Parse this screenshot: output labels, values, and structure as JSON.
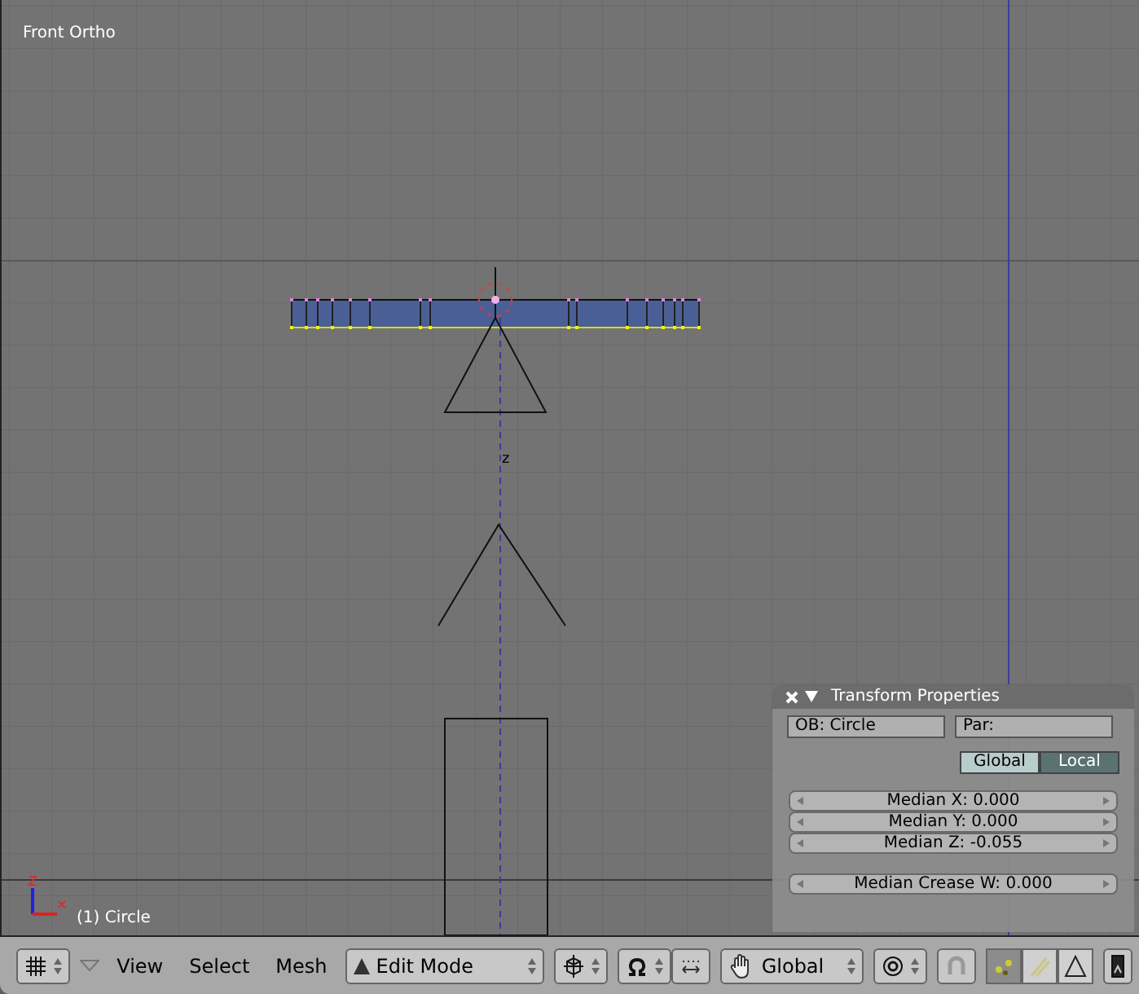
{
  "viewport": {
    "title": "Front Ortho",
    "axis_label": "z",
    "object_info": "(1) Circle"
  },
  "transform_panel": {
    "title": "Transform Properties",
    "object_field": "OB: Circle",
    "parent_field": "Par:",
    "space_toggle": [
      {
        "label": "Global",
        "selected": false
      },
      {
        "label": "Local",
        "selected": true
      }
    ],
    "median_fields": [
      "Median X: 0.000",
      "Median Y: 0.000",
      "Median Z: -0.055"
    ],
    "crease_field": "Median Crease W: 0.000"
  },
  "header": {
    "menus": [
      "View",
      "Select",
      "Mesh"
    ],
    "mode": "Edit Mode",
    "orientation": "Global",
    "select_modes": [
      {
        "kind": "vertex",
        "selected": true
      },
      {
        "kind": "edge",
        "selected": false
      },
      {
        "kind": "face",
        "selected": false
      }
    ]
  }
}
